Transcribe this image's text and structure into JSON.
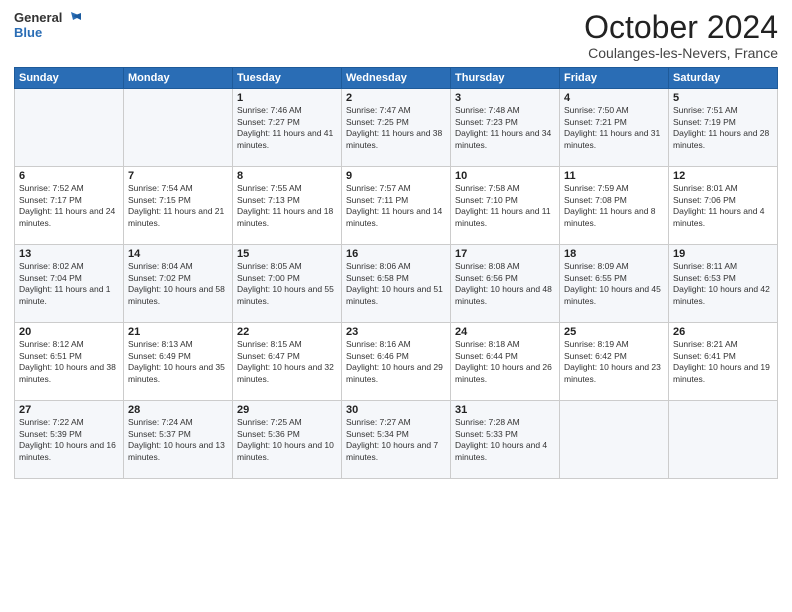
{
  "header": {
    "logo_line1": "General",
    "logo_line2": "Blue",
    "month": "October 2024",
    "location": "Coulanges-les-Nevers, France"
  },
  "weekdays": [
    "Sunday",
    "Monday",
    "Tuesday",
    "Wednesday",
    "Thursday",
    "Friday",
    "Saturday"
  ],
  "weeks": [
    [
      {
        "day": "",
        "info": ""
      },
      {
        "day": "",
        "info": ""
      },
      {
        "day": "1",
        "info": "Sunrise: 7:46 AM\nSunset: 7:27 PM\nDaylight: 11 hours and 41 minutes."
      },
      {
        "day": "2",
        "info": "Sunrise: 7:47 AM\nSunset: 7:25 PM\nDaylight: 11 hours and 38 minutes."
      },
      {
        "day": "3",
        "info": "Sunrise: 7:48 AM\nSunset: 7:23 PM\nDaylight: 11 hours and 34 minutes."
      },
      {
        "day": "4",
        "info": "Sunrise: 7:50 AM\nSunset: 7:21 PM\nDaylight: 11 hours and 31 minutes."
      },
      {
        "day": "5",
        "info": "Sunrise: 7:51 AM\nSunset: 7:19 PM\nDaylight: 11 hours and 28 minutes."
      }
    ],
    [
      {
        "day": "6",
        "info": "Sunrise: 7:52 AM\nSunset: 7:17 PM\nDaylight: 11 hours and 24 minutes."
      },
      {
        "day": "7",
        "info": "Sunrise: 7:54 AM\nSunset: 7:15 PM\nDaylight: 11 hours and 21 minutes."
      },
      {
        "day": "8",
        "info": "Sunrise: 7:55 AM\nSunset: 7:13 PM\nDaylight: 11 hours and 18 minutes."
      },
      {
        "day": "9",
        "info": "Sunrise: 7:57 AM\nSunset: 7:11 PM\nDaylight: 11 hours and 14 minutes."
      },
      {
        "day": "10",
        "info": "Sunrise: 7:58 AM\nSunset: 7:10 PM\nDaylight: 11 hours and 11 minutes."
      },
      {
        "day": "11",
        "info": "Sunrise: 7:59 AM\nSunset: 7:08 PM\nDaylight: 11 hours and 8 minutes."
      },
      {
        "day": "12",
        "info": "Sunrise: 8:01 AM\nSunset: 7:06 PM\nDaylight: 11 hours and 4 minutes."
      }
    ],
    [
      {
        "day": "13",
        "info": "Sunrise: 8:02 AM\nSunset: 7:04 PM\nDaylight: 11 hours and 1 minute."
      },
      {
        "day": "14",
        "info": "Sunrise: 8:04 AM\nSunset: 7:02 PM\nDaylight: 10 hours and 58 minutes."
      },
      {
        "day": "15",
        "info": "Sunrise: 8:05 AM\nSunset: 7:00 PM\nDaylight: 10 hours and 55 minutes."
      },
      {
        "day": "16",
        "info": "Sunrise: 8:06 AM\nSunset: 6:58 PM\nDaylight: 10 hours and 51 minutes."
      },
      {
        "day": "17",
        "info": "Sunrise: 8:08 AM\nSunset: 6:56 PM\nDaylight: 10 hours and 48 minutes."
      },
      {
        "day": "18",
        "info": "Sunrise: 8:09 AM\nSunset: 6:55 PM\nDaylight: 10 hours and 45 minutes."
      },
      {
        "day": "19",
        "info": "Sunrise: 8:11 AM\nSunset: 6:53 PM\nDaylight: 10 hours and 42 minutes."
      }
    ],
    [
      {
        "day": "20",
        "info": "Sunrise: 8:12 AM\nSunset: 6:51 PM\nDaylight: 10 hours and 38 minutes."
      },
      {
        "day": "21",
        "info": "Sunrise: 8:13 AM\nSunset: 6:49 PM\nDaylight: 10 hours and 35 minutes."
      },
      {
        "day": "22",
        "info": "Sunrise: 8:15 AM\nSunset: 6:47 PM\nDaylight: 10 hours and 32 minutes."
      },
      {
        "day": "23",
        "info": "Sunrise: 8:16 AM\nSunset: 6:46 PM\nDaylight: 10 hours and 29 minutes."
      },
      {
        "day": "24",
        "info": "Sunrise: 8:18 AM\nSunset: 6:44 PM\nDaylight: 10 hours and 26 minutes."
      },
      {
        "day": "25",
        "info": "Sunrise: 8:19 AM\nSunset: 6:42 PM\nDaylight: 10 hours and 23 minutes."
      },
      {
        "day": "26",
        "info": "Sunrise: 8:21 AM\nSunset: 6:41 PM\nDaylight: 10 hours and 19 minutes."
      }
    ],
    [
      {
        "day": "27",
        "info": "Sunrise: 7:22 AM\nSunset: 5:39 PM\nDaylight: 10 hours and 16 minutes."
      },
      {
        "day": "28",
        "info": "Sunrise: 7:24 AM\nSunset: 5:37 PM\nDaylight: 10 hours and 13 minutes."
      },
      {
        "day": "29",
        "info": "Sunrise: 7:25 AM\nSunset: 5:36 PM\nDaylight: 10 hours and 10 minutes."
      },
      {
        "day": "30",
        "info": "Sunrise: 7:27 AM\nSunset: 5:34 PM\nDaylight: 10 hours and 7 minutes."
      },
      {
        "day": "31",
        "info": "Sunrise: 7:28 AM\nSunset: 5:33 PM\nDaylight: 10 hours and 4 minutes."
      },
      {
        "day": "",
        "info": ""
      },
      {
        "day": "",
        "info": ""
      }
    ]
  ]
}
